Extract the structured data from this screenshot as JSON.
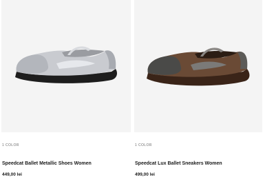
{
  "products": [
    {
      "color_count": "1 COLOR",
      "name": "Speedcat Ballet Metallic Shoes Women",
      "price": "449,00 lei",
      "image_icon": "silver-ballet-shoe-image",
      "colors": {
        "upper": "#c9cbd0",
        "sole": "#1d1d1d",
        "accent": "#e6e8ec"
      }
    },
    {
      "color_count": "1 COLOR",
      "name": "Speedcat Lux Ballet Sneakers Women",
      "price": "499,00 lei",
      "image_icon": "brown-ballet-sneaker-image",
      "colors": {
        "upper": "#6a4a35",
        "sole": "#3a2418",
        "accent": "#7b7a78"
      }
    }
  ],
  "theme": {
    "image_bg": "#f4f4f4",
    "text": "#1a1a1a",
    "muted": "#6b6b6b"
  }
}
